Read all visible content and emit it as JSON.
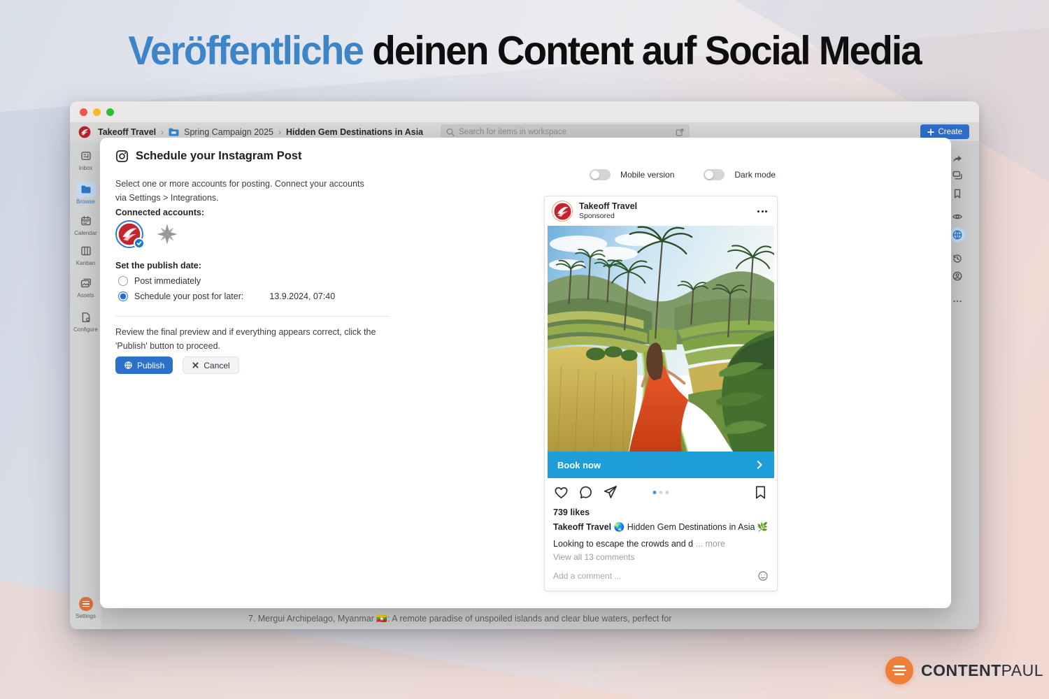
{
  "hero": {
    "highlight": "Veröffentliche",
    "rest": "deinen Content auf Social Media"
  },
  "window": {
    "breadcrumb": {
      "workspace": "Takeoff Travel",
      "folder": "Spring Campaign 2025",
      "item": "Hidden Gem Destinations in Asia"
    },
    "search": {
      "placeholder": "Search for items in workspace"
    },
    "create_label": "Create",
    "sidebar": {
      "items": [
        {
          "label": "Inbox",
          "active": false
        },
        {
          "label": "Browse",
          "active": true
        },
        {
          "label": "Calendar",
          "active": false
        },
        {
          "label": "Kanban",
          "active": false
        },
        {
          "label": "Assets",
          "active": false
        },
        {
          "label": "Configure",
          "active": false
        }
      ],
      "settings_label": "Settings"
    },
    "right_rail_icons": [
      "share",
      "comments",
      "bookmark",
      "watch",
      "publish-globe",
      "history",
      "account",
      "more"
    ],
    "background_text": "7. Mergui Archipelago, Myanmar 🇲🇲: A remote paradise of unspoiled islands and clear blue waters, perfect for"
  },
  "modal": {
    "title": "Schedule your Instagram Post",
    "intro": "Select one or more accounts for posting. Connect your accounts via Settings > Integrations.",
    "connected_accounts_label": "Connected accounts:",
    "publish_date_label": "Set the publish date:",
    "radio_options": [
      {
        "label": "Post immediately",
        "selected": false
      },
      {
        "label": "Schedule your post for later:",
        "selected": true
      }
    ],
    "scheduled_datetime": "13.9.2024, 07:40",
    "review_text": "Review the final preview and if everything appears correct, click the 'Publish' button to proceed.",
    "publish_label": "Publish",
    "cancel_label": "Cancel",
    "toggles": [
      {
        "label": "Mobile version",
        "on": false
      },
      {
        "label": "Dark mode",
        "on": false
      }
    ]
  },
  "instagram_preview": {
    "account_name": "Takeoff Travel",
    "sponsored_label": "Sponsored",
    "cta_label": "Book now",
    "likes": "739 likes",
    "caption_author": "Takeoff Travel",
    "caption_emoji": "🌏",
    "caption_text": "Hidden Gem Destinations in Asia",
    "caption_trailing_emoji": "🌿",
    "preview_text": "Looking to escape the crowds and d",
    "more_label": "... more",
    "view_comments": "View all 13 comments",
    "comment_placeholder": "Add a comment ...",
    "carousel": {
      "dots": 3,
      "active": 1
    }
  },
  "branding": {
    "logo_bold": "CONTENT",
    "logo_light": "PAUL"
  },
  "colors": {
    "hero_blue": "#3d85c9",
    "create_blue": "#2e6ec9",
    "publish_blue": "#2b71ca",
    "cta_blue": "#1d9ed9",
    "radio_blue": "#1a73d2",
    "active_item_blue": "#2c77c9",
    "settings_orange": "#dd6f3e",
    "brand_orange": "#ef7f38"
  }
}
